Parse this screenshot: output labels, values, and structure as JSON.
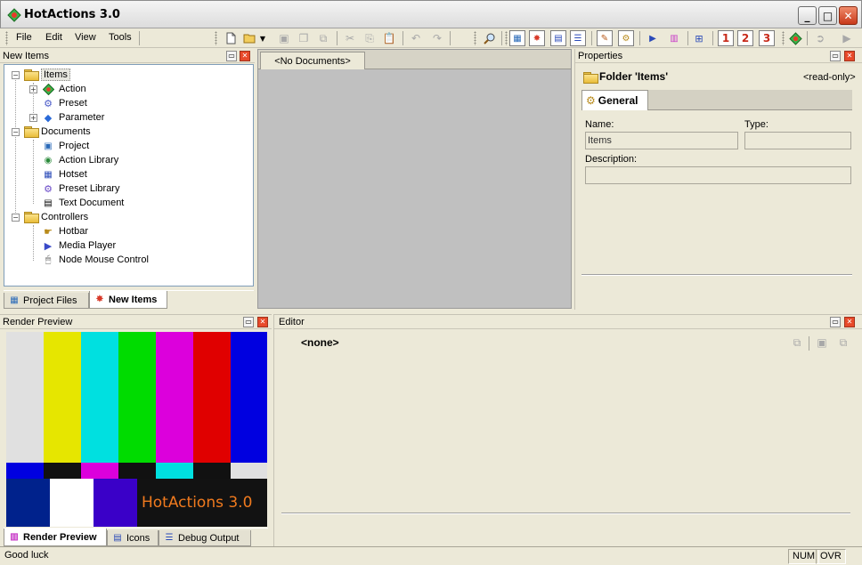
{
  "window": {
    "title": "HotActions 3.0",
    "minimize_label": "_",
    "maximize_label": "□",
    "close_label": "✕"
  },
  "menu": {
    "items": [
      "File",
      "Edit",
      "View",
      "Tools"
    ]
  },
  "toolbar": {
    "numbered_buttons": [
      "1",
      "2",
      "3"
    ]
  },
  "new_items_panel": {
    "title": "New Items",
    "tree": [
      {
        "label": "Items",
        "children": [
          "Action",
          "Preset",
          "Parameter"
        ]
      },
      {
        "label": "Documents",
        "children": [
          "Project",
          "Action Library",
          "Hotset",
          "Preset Library",
          "Text Document"
        ]
      },
      {
        "label": "Controllers",
        "children": [
          "Hotbar",
          "Media Player",
          "Node Mouse Control"
        ]
      }
    ],
    "tabs": [
      "Project Files",
      "New Items"
    ]
  },
  "documents": {
    "tab_label": "<No Documents>"
  },
  "properties_panel": {
    "title": "Properties",
    "folder_heading": "Folder 'Items'",
    "readonly_label": "<read-only>",
    "tab_label": "General",
    "name_label": "Name:",
    "name_value": "Items",
    "type_label": "Type:",
    "type_value": "",
    "description_label": "Description:",
    "description_value": ""
  },
  "render_preview_panel": {
    "title": "Render Preview",
    "overlay_text": "HotActions 3.0",
    "overlay_color": "#f07a1e",
    "bar_colors": [
      "#e0e0e0",
      "#e6e600",
      "#00e0e0",
      "#00dc00",
      "#dc00dc",
      "#e00000",
      "#0000e0"
    ],
    "tabs": [
      "Render Preview",
      "Icons",
      "Debug Output"
    ]
  },
  "editor_panel": {
    "title": "Editor",
    "content_label": "<none>"
  },
  "statusbar": {
    "text": "Good luck",
    "num": "NUM",
    "ovr": "OVR"
  }
}
